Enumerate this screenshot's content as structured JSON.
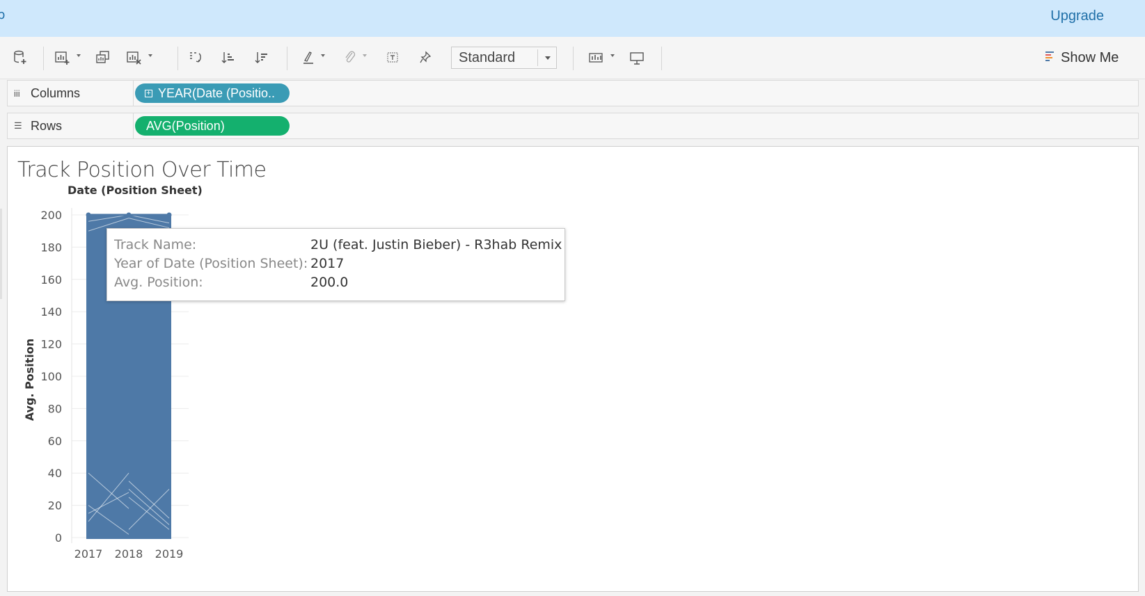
{
  "topbar": {
    "edge_glyph": "þ",
    "upgrade": "Upgrade"
  },
  "toolbar": {
    "icons": [
      "new-data-source-icon",
      "new-worksheet-icon",
      "duplicate-sheet-icon",
      "clear-sheet-icon",
      "swap-axes-icon",
      "sort-ascending-icon",
      "sort-descending-icon",
      "highlight-icon",
      "group-icon",
      "label-icon",
      "pin-icon",
      "show-cards-icon",
      "presentation-icon"
    ],
    "fit_select": "Standard",
    "show_me": "Show Me"
  },
  "shelves": {
    "columns": {
      "label": "Columns",
      "pill": "YEAR(Date (Positio.."
    },
    "rows": {
      "label": "Rows",
      "pill": "AVG(Position)"
    }
  },
  "sheet": {
    "title": "Track Position Over Time"
  },
  "chart_data": {
    "type": "line",
    "title": "Track Position Over Time",
    "column_header": "Date (Position Sheet)",
    "xlabel": "",
    "ylabel": "Avg. Position",
    "categories": [
      "2017",
      "2018",
      "2019"
    ],
    "yticks": [
      0,
      20,
      40,
      60,
      80,
      100,
      120,
      140,
      160,
      180,
      200
    ],
    "ylim": [
      0,
      200
    ],
    "series_color": "#4e79a7",
    "grid": true,
    "note_visible": "many overlapping track lines spanning 0-200 in each year",
    "highlighted_track": {
      "name": "2U (feat. Justin Bieber) - R3hab Remix",
      "values": [
        200,
        200,
        200
      ]
    }
  },
  "tooltip": {
    "rows": [
      {
        "key": "Track Name:",
        "value": "2U (feat. Justin Bieber) - R3hab Remix"
      },
      {
        "key": "Year of Date (Position Sheet):",
        "value": "2017"
      },
      {
        "key": "Avg. Position:",
        "value": "200.0"
      }
    ]
  }
}
